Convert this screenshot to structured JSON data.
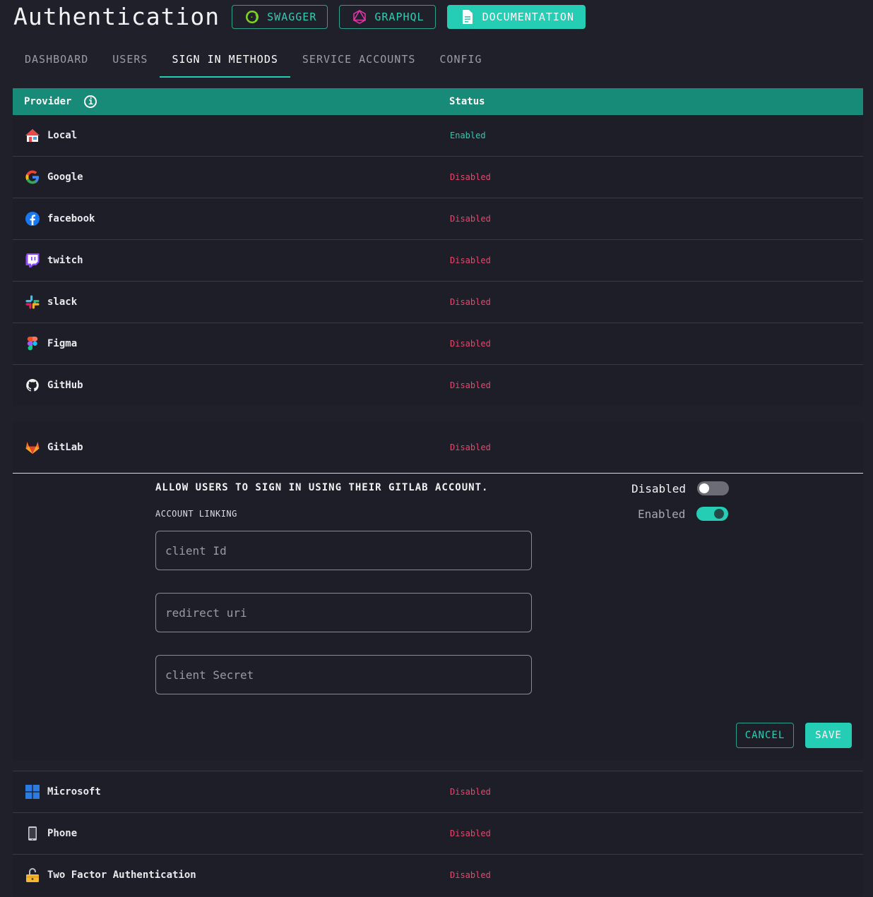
{
  "header": {
    "title": "Authentication",
    "buttons": [
      {
        "label": "SWAGGER",
        "icon": "swagger-icon"
      },
      {
        "label": "GRAPHQL",
        "icon": "graphql-icon"
      },
      {
        "label": "DOCUMENTATION",
        "icon": "document-icon"
      }
    ]
  },
  "tabs": [
    {
      "label": "DASHBOARD"
    },
    {
      "label": "USERS"
    },
    {
      "label": "SIGN IN METHODS",
      "active": true
    },
    {
      "label": "SERVICE ACCOUNTS"
    },
    {
      "label": "CONFIG"
    }
  ],
  "table": {
    "col_provider": "Provider",
    "col_status": "Status",
    "providers_top": [
      {
        "name": "Local",
        "status": "Enabled",
        "icon": "house-icon"
      },
      {
        "name": "Google",
        "status": "Disabled",
        "icon": "google-icon"
      },
      {
        "name": "facebook",
        "status": "Disabled",
        "icon": "facebook-icon"
      },
      {
        "name": "twitch",
        "status": "Disabled",
        "icon": "twitch-icon"
      },
      {
        "name": "slack",
        "status": "Disabled",
        "icon": "slack-icon"
      },
      {
        "name": "Figma",
        "status": "Disabled",
        "icon": "figma-icon"
      },
      {
        "name": "GitHub",
        "status": "Disabled",
        "icon": "github-icon"
      }
    ],
    "providers_bottom": [
      {
        "name": "Microsoft",
        "status": "Disabled",
        "icon": "microsoft-icon"
      },
      {
        "name": "Phone",
        "status": "Disabled",
        "icon": "phone-icon"
      },
      {
        "name": "Two Factor Authentication",
        "status": "Disabled",
        "icon": "lock-icon"
      }
    ]
  },
  "gitlab": {
    "name": "GitLab",
    "status": "Disabled",
    "allow_text": "ALLOW USERS TO SIGN IN USING THEIR GITLAB ACCOUNT.",
    "account_linking_label": "ACCOUNT LINKING",
    "provider_toggle": {
      "label": "Disabled",
      "on": false
    },
    "linking_toggle": {
      "label": "Enabled",
      "on": true
    },
    "fields": {
      "client_id": {
        "placeholder": "client Id",
        "value": ""
      },
      "redirect_uri": {
        "placeholder": "redirect uri",
        "value": ""
      },
      "client_secret": {
        "placeholder": "client Secret",
        "value": ""
      }
    },
    "cancel_label": "CANCEL",
    "save_label": "SAVE"
  },
  "colors": {
    "accent": "#24cdb3",
    "table_header": "#178a78",
    "enabled": "#2ecbb0",
    "disabled": "#e5486d",
    "background": "#1f2029"
  }
}
